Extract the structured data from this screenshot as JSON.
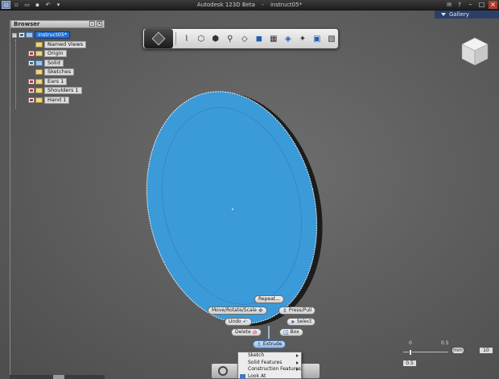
{
  "app": {
    "title": "Autodesk 123D Beta",
    "document": "instruct05*",
    "separator": "-"
  },
  "gallery": {
    "label": "Gallery"
  },
  "browser": {
    "title": "Browser",
    "root": "instruct05*",
    "items": [
      {
        "label": "Named Views",
        "icon": "folder-icon",
        "visible": null
      },
      {
        "label": "Origin",
        "icon": "folder-icon",
        "visible": false
      },
      {
        "label": "Solid",
        "icon": "folder-icon",
        "visible": true
      },
      {
        "label": "Sketches",
        "icon": "folder-icon",
        "visible": null
      },
      {
        "label": "Ears 1",
        "icon": "folder-icon",
        "visible": false
      },
      {
        "label": "Shoulders 1",
        "icon": "folder-icon",
        "visible": false
      },
      {
        "label": "Hand 1",
        "icon": "folder-icon",
        "visible": false
      }
    ]
  },
  "marking_menu": {
    "repeat": "Repeat...",
    "move_rotate_scale": "Move/Rotate/Scale",
    "press_pull": "Press/Pull",
    "undo": "Undo",
    "select": "Select",
    "delete": "Delete",
    "box": "Box",
    "extrude": "Extrude"
  },
  "context_menu": {
    "items": [
      {
        "label": "Sketch",
        "submenu": true
      },
      {
        "label": "Solid Features",
        "submenu": true
      },
      {
        "label": "Construction Features",
        "submenu": true
      },
      {
        "label": "Look At",
        "submenu": false
      }
    ]
  },
  "snap": {
    "tick_left": "0",
    "tick_right": "0.5",
    "unit": "mm",
    "grid": "10",
    "value": "0.5"
  },
  "colors": {
    "disc_face": "#3b9ad8",
    "selection": "#2d6fb8",
    "titlebar": "#2a2a2a",
    "gallery": "#2a3f66"
  }
}
